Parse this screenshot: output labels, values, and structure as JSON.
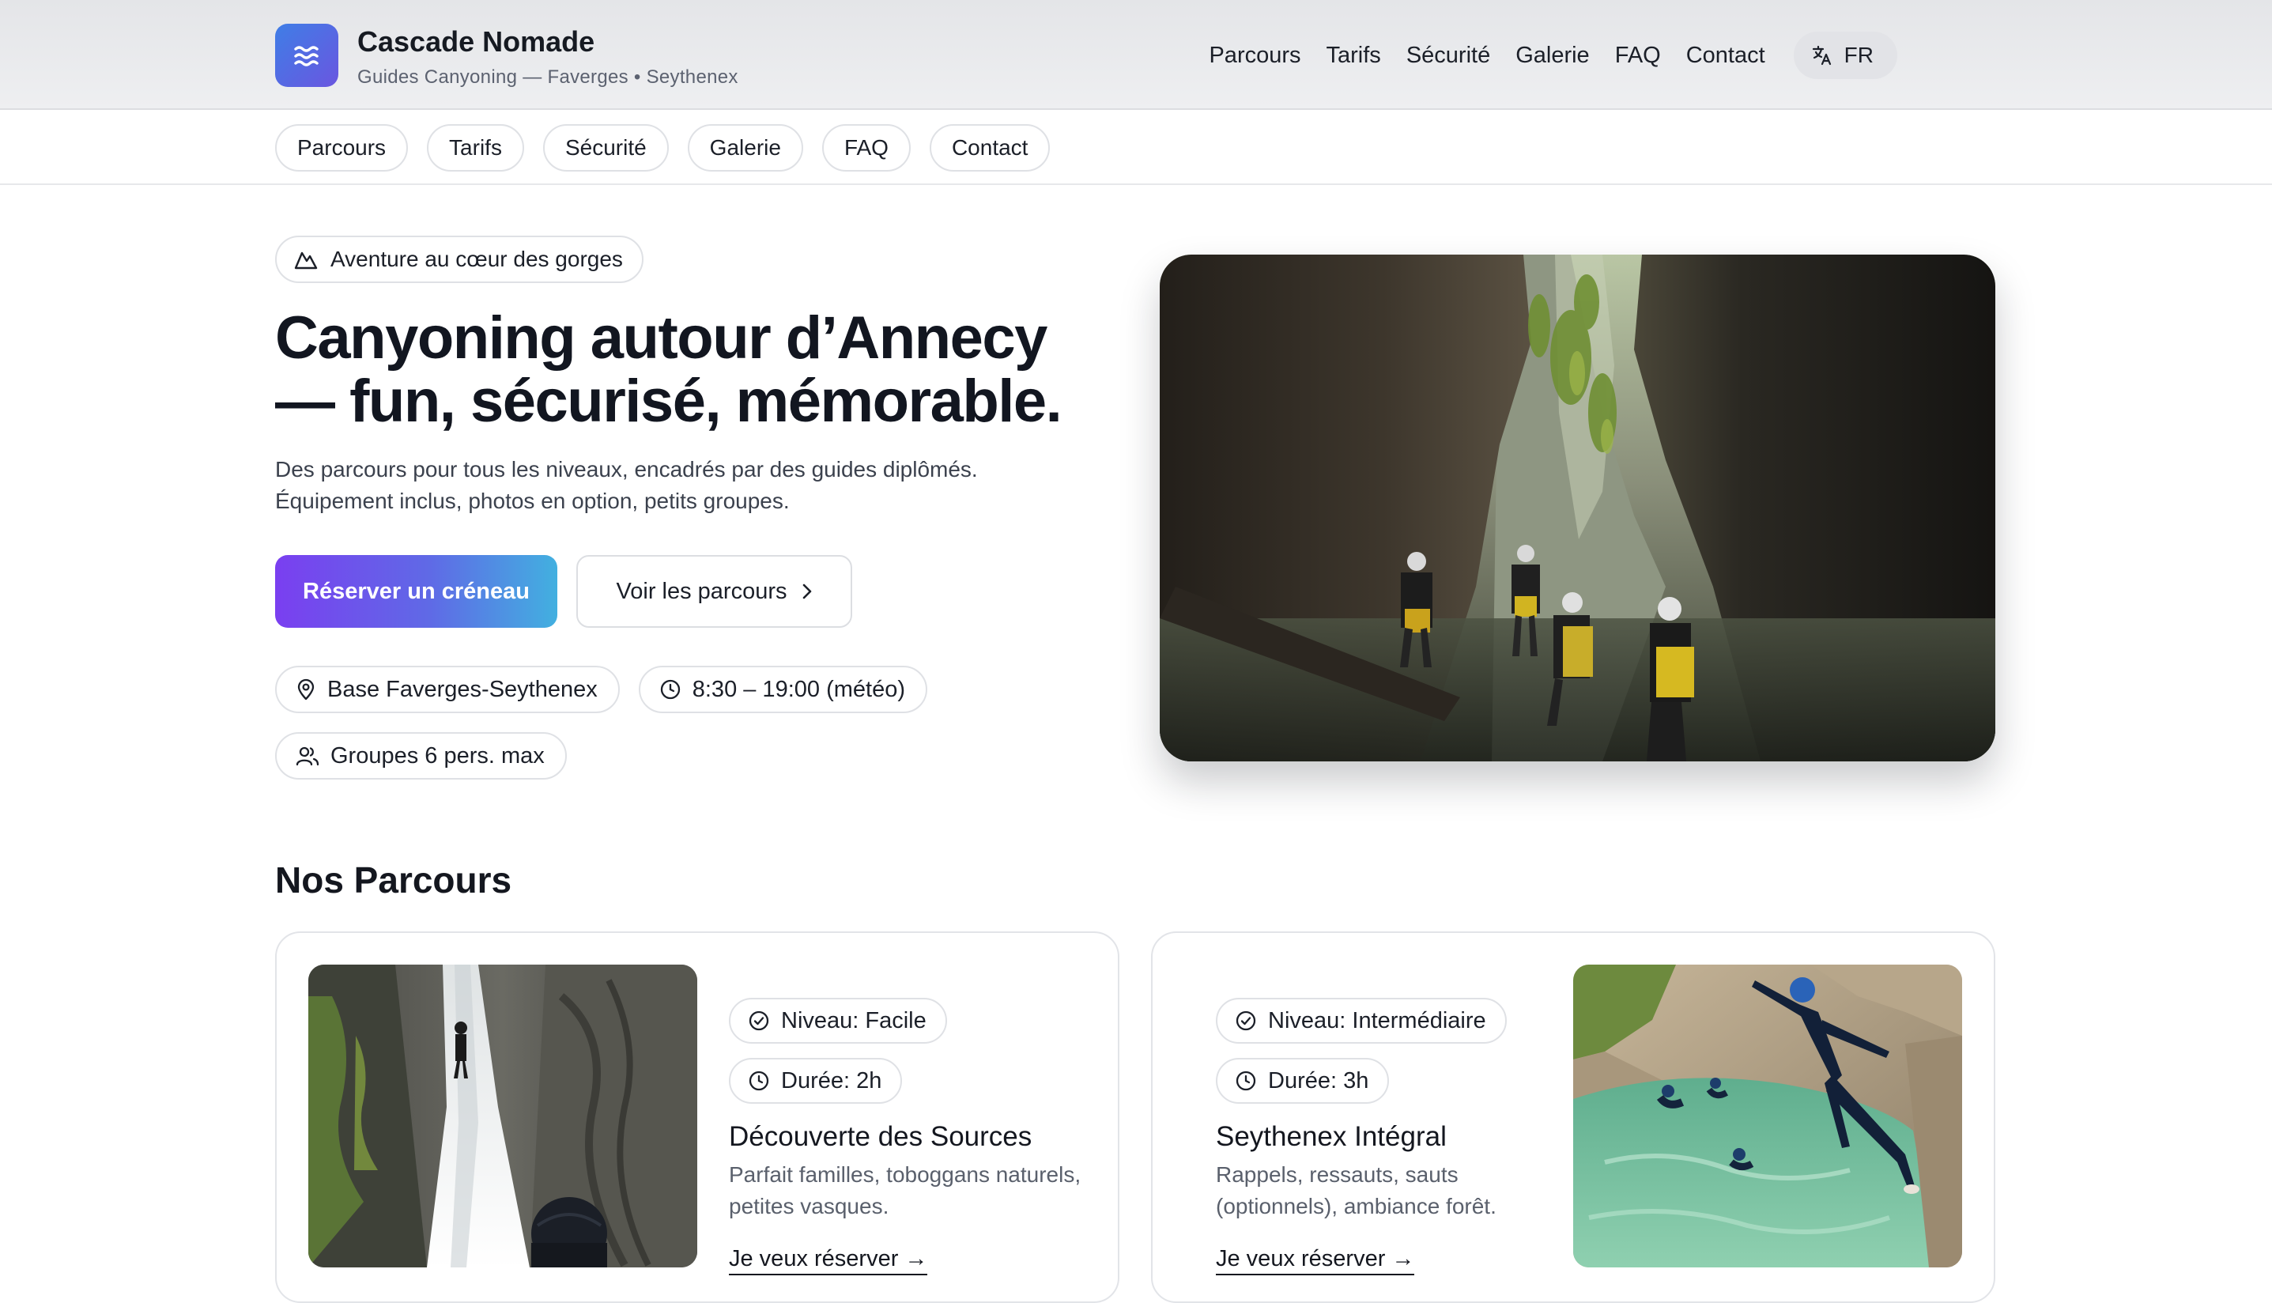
{
  "brand": {
    "name": "Cascade Nomade",
    "subtitle": "Guides Canyoning — Faverges • Seythenex",
    "logo_icon": "waves-icon"
  },
  "topnav": {
    "items": [
      "Parcours",
      "Tarifs",
      "Sécurité",
      "Galerie",
      "FAQ",
      "Contact"
    ],
    "lang_label": "FR",
    "lang_icon": "translate-icon"
  },
  "subnav": {
    "items": [
      "Parcours",
      "Tarifs",
      "Sécurité",
      "Galerie",
      "FAQ",
      "Contact"
    ]
  },
  "hero": {
    "eyebrow": "Aventure au cœur des gorges",
    "eyebrow_icon": "mountain-icon",
    "title": "Canyoning autour d’Annecy — fun, sécurisé, mémorable.",
    "text": "Des parcours pour tous les niveaux, encadrés par des guides diplômés. Équipement inclus, photos en option, petits groupes.",
    "primary_cta": "Réserver un créneau",
    "secondary_cta": "Voir les parcours",
    "chips": [
      {
        "icon": "map-pin-icon",
        "label": "Base Faverges-Seythenex"
      },
      {
        "icon": "clock-icon",
        "label": "8:30 – 19:00 (météo)"
      },
      {
        "icon": "users-icon",
        "label": "Groupes 6 pers. max"
      }
    ]
  },
  "section": {
    "title": "Nos Parcours",
    "cards": [
      {
        "level": "Niveau: Facile",
        "duration": "Durée: 2h",
        "title": "Découverte des Sources",
        "desc": "Parfait familles, toboggans naturels, petites vasques.",
        "link": "Je veux réserver →"
      },
      {
        "level": "Niveau: Intermédiaire",
        "duration": "Durée: 3h",
        "title": "Seythenex Intégral",
        "desc": "Rappels, ressauts, sauts (optionnels), ambiance forêt.",
        "link": "Je veux réserver →"
      }
    ]
  },
  "colors": {
    "accent_start": "#7a3ff0",
    "accent_end": "#42b0e0",
    "logo": "#4f6fe3",
    "text": "#14171f",
    "muted": "#5a606c",
    "border": "#dfe1e5"
  }
}
